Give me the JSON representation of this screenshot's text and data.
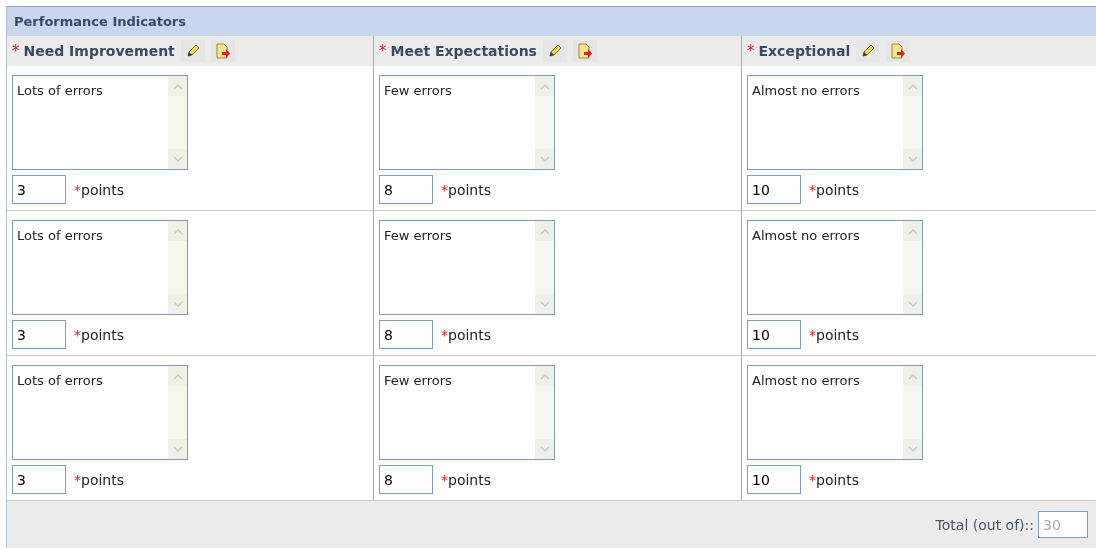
{
  "panel": {
    "title": "Performance Indicators"
  },
  "columns": [
    {
      "marker": "*",
      "label": "Need Improvement",
      "required": true
    },
    {
      "marker": "*",
      "label": "Meet Expectations",
      "required": true
    },
    {
      "marker": "*",
      "label": "Exceptional",
      "required": true
    }
  ],
  "points_marker": "*",
  "rows": [
    {
      "cells": [
        {
          "description": "Lots of errors",
          "points": "3",
          "points_label": "points"
        },
        {
          "description": "Few errors",
          "points": "8",
          "points_label": "points"
        },
        {
          "description": "Almost no errors",
          "points": "10",
          "points_label": "points"
        }
      ]
    },
    {
      "cells": [
        {
          "description": "Lots of errors",
          "points": "3",
          "points_label": "points"
        },
        {
          "description": "Few errors",
          "points": "8",
          "points_label": "points"
        },
        {
          "description": "Almost no errors",
          "points": "10",
          "points_label": "points"
        }
      ]
    },
    {
      "cells": [
        {
          "description": "Lots of errors",
          "points": "3",
          "points_label": "points"
        },
        {
          "description": "Few errors",
          "points": "8",
          "points_label": "points"
        },
        {
          "description": "Almost no errors",
          "points": "10",
          "points_label": "points"
        }
      ]
    }
  ],
  "total": {
    "label": "Total (out of)::",
    "value": "30",
    "disabled": true
  }
}
